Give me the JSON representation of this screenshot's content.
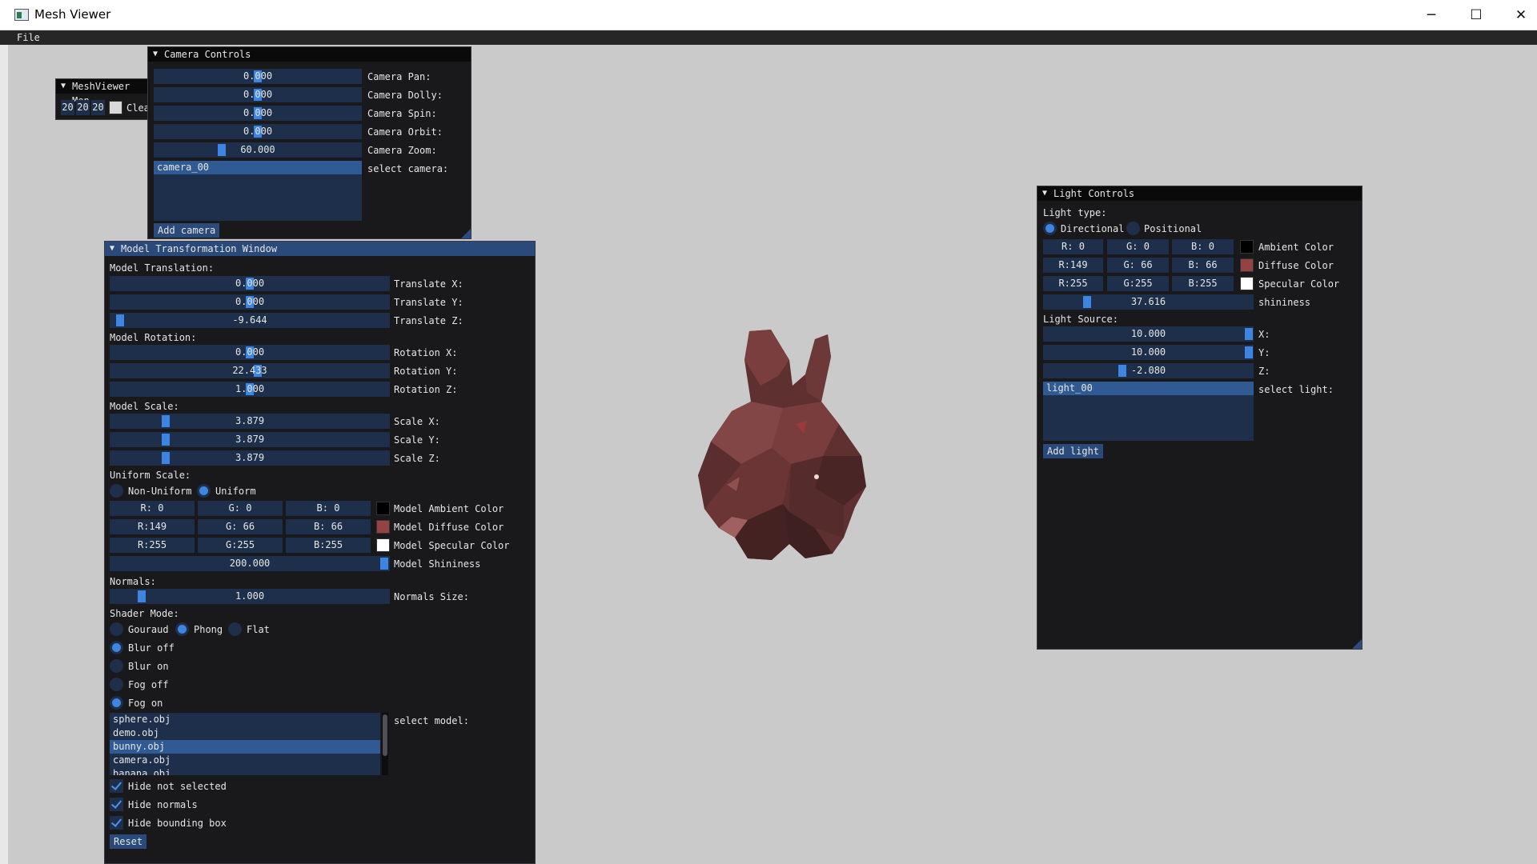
{
  "window": {
    "title": "Mesh Viewer",
    "min_icon": "─",
    "max_icon": "☐",
    "close_icon": "✕"
  },
  "menu": {
    "file": "File"
  },
  "meshviewer_menu": {
    "title": "MeshViewer Menu",
    "title_visible": "MeshViewer Men",
    "r": "20",
    "g": "20",
    "b": "20",
    "clear_label": "Clea",
    "clear_color": "#d9d9d9"
  },
  "camera": {
    "title": "Camera Controls",
    "sliders": [
      {
        "label": "Camera Pan:",
        "value": "0.000",
        "fraction": 0.5
      },
      {
        "label": "Camera Dolly:",
        "value": "0.000",
        "fraction": 0.5
      },
      {
        "label": "Camera Spin:",
        "value": "0.000",
        "fraction": 0.5
      },
      {
        "label": "Camera Orbit:",
        "value": "0.000",
        "fraction": 0.5
      },
      {
        "label": "Camera Zoom:",
        "value": "60.000",
        "fraction": 0.3
      }
    ],
    "list": [
      "camera_00"
    ],
    "select_label": "select camera:",
    "add_button": "Add camera"
  },
  "model": {
    "title": "Model Transformation Window",
    "translation_header": "Model Translation:",
    "translation": [
      {
        "label": "Translate X:",
        "value": "0.000",
        "fraction": 0.5
      },
      {
        "label": "Translate Y:",
        "value": "0.000",
        "fraction": 0.5
      },
      {
        "label": "Translate Z:",
        "value": "-9.644",
        "fraction": 0.02
      }
    ],
    "rotation_header": "Model Rotation:",
    "rotation": [
      {
        "label": "Rotation X:",
        "value": "0.000",
        "fraction": 0.5
      },
      {
        "label": "Rotation Y:",
        "value": "22.433",
        "fraction": 0.53
      },
      {
        "label": "Rotation Z:",
        "value": "1.000",
        "fraction": 0.5
      }
    ],
    "scale_header": "Model Scale:",
    "scale": [
      {
        "label": "Scale X:",
        "value": "3.879",
        "fraction": 0.2
      },
      {
        "label": "Scale Y:",
        "value": "3.879",
        "fraction": 0.2
      },
      {
        "label": "Scale Z:",
        "value": "3.879",
        "fraction": 0.2
      }
    ],
    "uniform_header": "Uniform Scale:",
    "uniform_options": [
      "Non-Uniform",
      "Uniform"
    ],
    "uniform_selected": "Uniform",
    "ambient": {
      "r": "R:  0",
      "g": "G:  0",
      "b": "B:  0",
      "color": "#000000",
      "label": "Model Ambient Color"
    },
    "diffuse": {
      "r": "R:149",
      "g": "G: 66",
      "b": "B: 66",
      "color": "#954242",
      "label": "Model Diffuse Color"
    },
    "specular": {
      "r": "R:255",
      "g": "G:255",
      "b": "B:255",
      "color": "#ffffff",
      "label": "Model Specular Color"
    },
    "shininess": {
      "value": "200.000",
      "fraction": 1.0,
      "label": "Model Shininess"
    },
    "normals_header": "Normals:",
    "normals_size": {
      "value": "1.000",
      "fraction": 0.1,
      "label": "Normals Size:"
    },
    "shader_header": "Shader Mode:",
    "shader_options": [
      "Gouraud",
      "Phong",
      "Flat"
    ],
    "shader_selected": "Phong",
    "blur_off": "Blur off",
    "blur_on": "Blur on",
    "fog_off": "Fog off",
    "fog_on": "Fog on",
    "models": [
      "sphere.obj",
      "demo.obj",
      "bunny.obj",
      "camera.obj",
      "banana.obj"
    ],
    "selected_model": "bunny.obj",
    "select_label": "select model:",
    "hide_not_selected": "Hide not selected",
    "hide_normals": "Hide normals",
    "hide_bbox": "Hide bounding box",
    "reset_button": "Reset"
  },
  "light": {
    "title": "Light Controls",
    "type_header": "Light type:",
    "type_options": [
      "Directional",
      "Positional"
    ],
    "type_selected": "Directional",
    "ambient": {
      "r": "R:  0",
      "g": "G:  0",
      "b": "B:  0",
      "color": "#000000",
      "label": "Ambient Color"
    },
    "diffuse": {
      "r": "R:149",
      "g": "G: 66",
      "b": "B: 66",
      "color": "#954242",
      "label": "Diffuse Color"
    },
    "specular": {
      "r": "R:255",
      "g": "G:255",
      "b": "B:255",
      "color": "#ffffff",
      "label": "Specular Color"
    },
    "shininess": {
      "value": "37.616",
      "fraction": 0.2,
      "label": "shininess"
    },
    "source_header": "Light Source:",
    "source": [
      {
        "label": "X:",
        "value": "10.000",
        "fraction": 1.0
      },
      {
        "label": "Y:",
        "value": "10.000",
        "fraction": 1.0
      },
      {
        "label": "Z:",
        "value": "-2.080",
        "fraction": 0.37
      }
    ],
    "list": [
      "light_00"
    ],
    "select_label": "select light:",
    "add_button": "Add light"
  },
  "colors": {
    "accent": "#3d85e0",
    "frame": "#1d2f4a",
    "title_active": "#294a7a",
    "panel": "#121214",
    "viewport": "#cacaca",
    "bunny": "#6b3535"
  }
}
